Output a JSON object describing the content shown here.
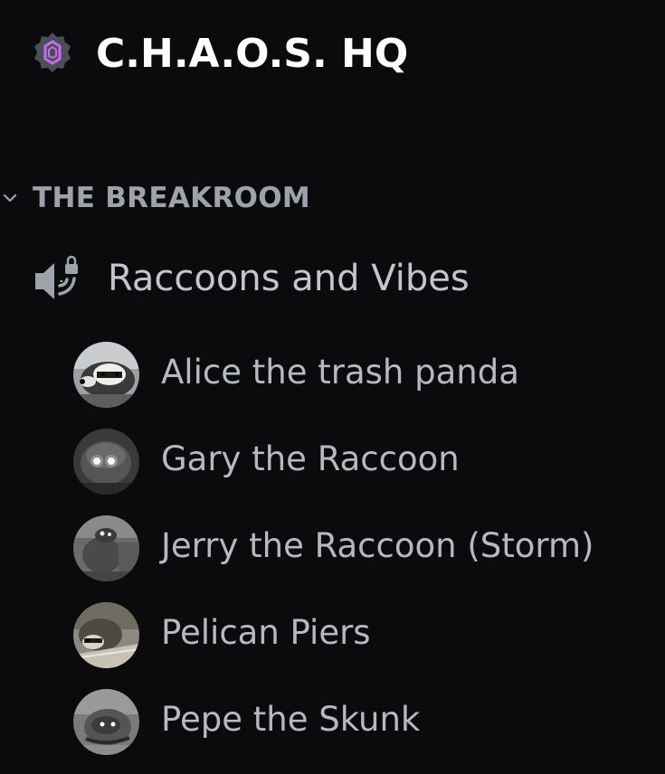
{
  "server": {
    "name": "C.H.A.O.S. HQ",
    "badge_icon": "server-boost-badge-icon",
    "badge_color": "#c46bf0"
  },
  "category": {
    "label": "THE BREAKROOM",
    "expanded": true,
    "chevron_icon": "chevron-down-icon"
  },
  "channel": {
    "name": "Raccoons and Vibes",
    "type": "voice",
    "icon": "locked-voice-channel-icon"
  },
  "members": [
    {
      "name": "Alice the trash panda",
      "avatar_icon": "raccoon-avatar"
    },
    {
      "name": "Gary the Raccoon",
      "avatar_icon": "raccoon-night-eyes-avatar"
    },
    {
      "name": "Jerry the Raccoon (Storm)",
      "avatar_icon": "raccoon-night-avatar"
    },
    {
      "name": "Pelican Piers",
      "avatar_icon": "raccoon-on-deck-avatar"
    },
    {
      "name": "Pepe the Skunk",
      "avatar_icon": "raccoon-glowing-eyes-avatar"
    }
  ],
  "colors": {
    "background": "#0b0b0d",
    "title": "#ffffff",
    "category": "#9ea3ab",
    "channel": "#c2c5cb",
    "member": "#b5b9c0"
  }
}
